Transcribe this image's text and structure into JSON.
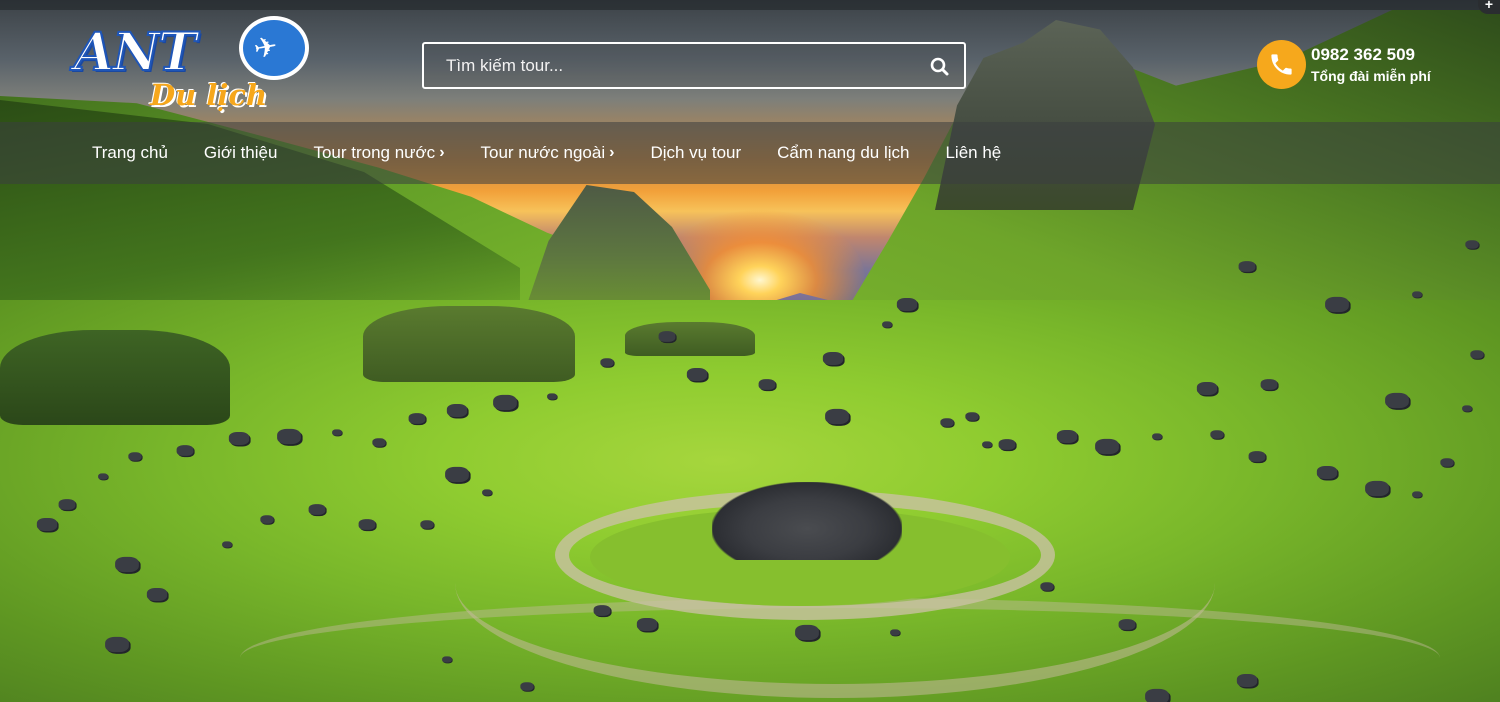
{
  "header": {
    "logo": {
      "main_text": "ANT",
      "sub_text": "Du lịch"
    },
    "search": {
      "placeholder": "Tìm kiếm tour..."
    },
    "hotline": {
      "number": "0982 362 509",
      "label": "Tổng đài miễn phí"
    }
  },
  "nav": {
    "items": [
      {
        "label": "Trang chủ",
        "has_submenu": false
      },
      {
        "label": "Giới thiệu",
        "has_submenu": false
      },
      {
        "label": "Tour trong nước",
        "has_submenu": true
      },
      {
        "label": "Tour nước ngoài",
        "has_submenu": true
      },
      {
        "label": "Dịch vụ tour",
        "has_submenu": false
      },
      {
        "label": "Cẩm nang du lịch",
        "has_submenu": false
      },
      {
        "label": "Liên hệ",
        "has_submenu": false
      }
    ]
  },
  "colors": {
    "accent": "#f6a81c",
    "logo_blue": "#2a78d4",
    "text": "#ffffff"
  },
  "icons": {
    "search": "search-icon",
    "phone": "phone-icon",
    "plane": "plane-icon",
    "submenu": "chevron-right-icon",
    "corner": "plus-icon"
  }
}
